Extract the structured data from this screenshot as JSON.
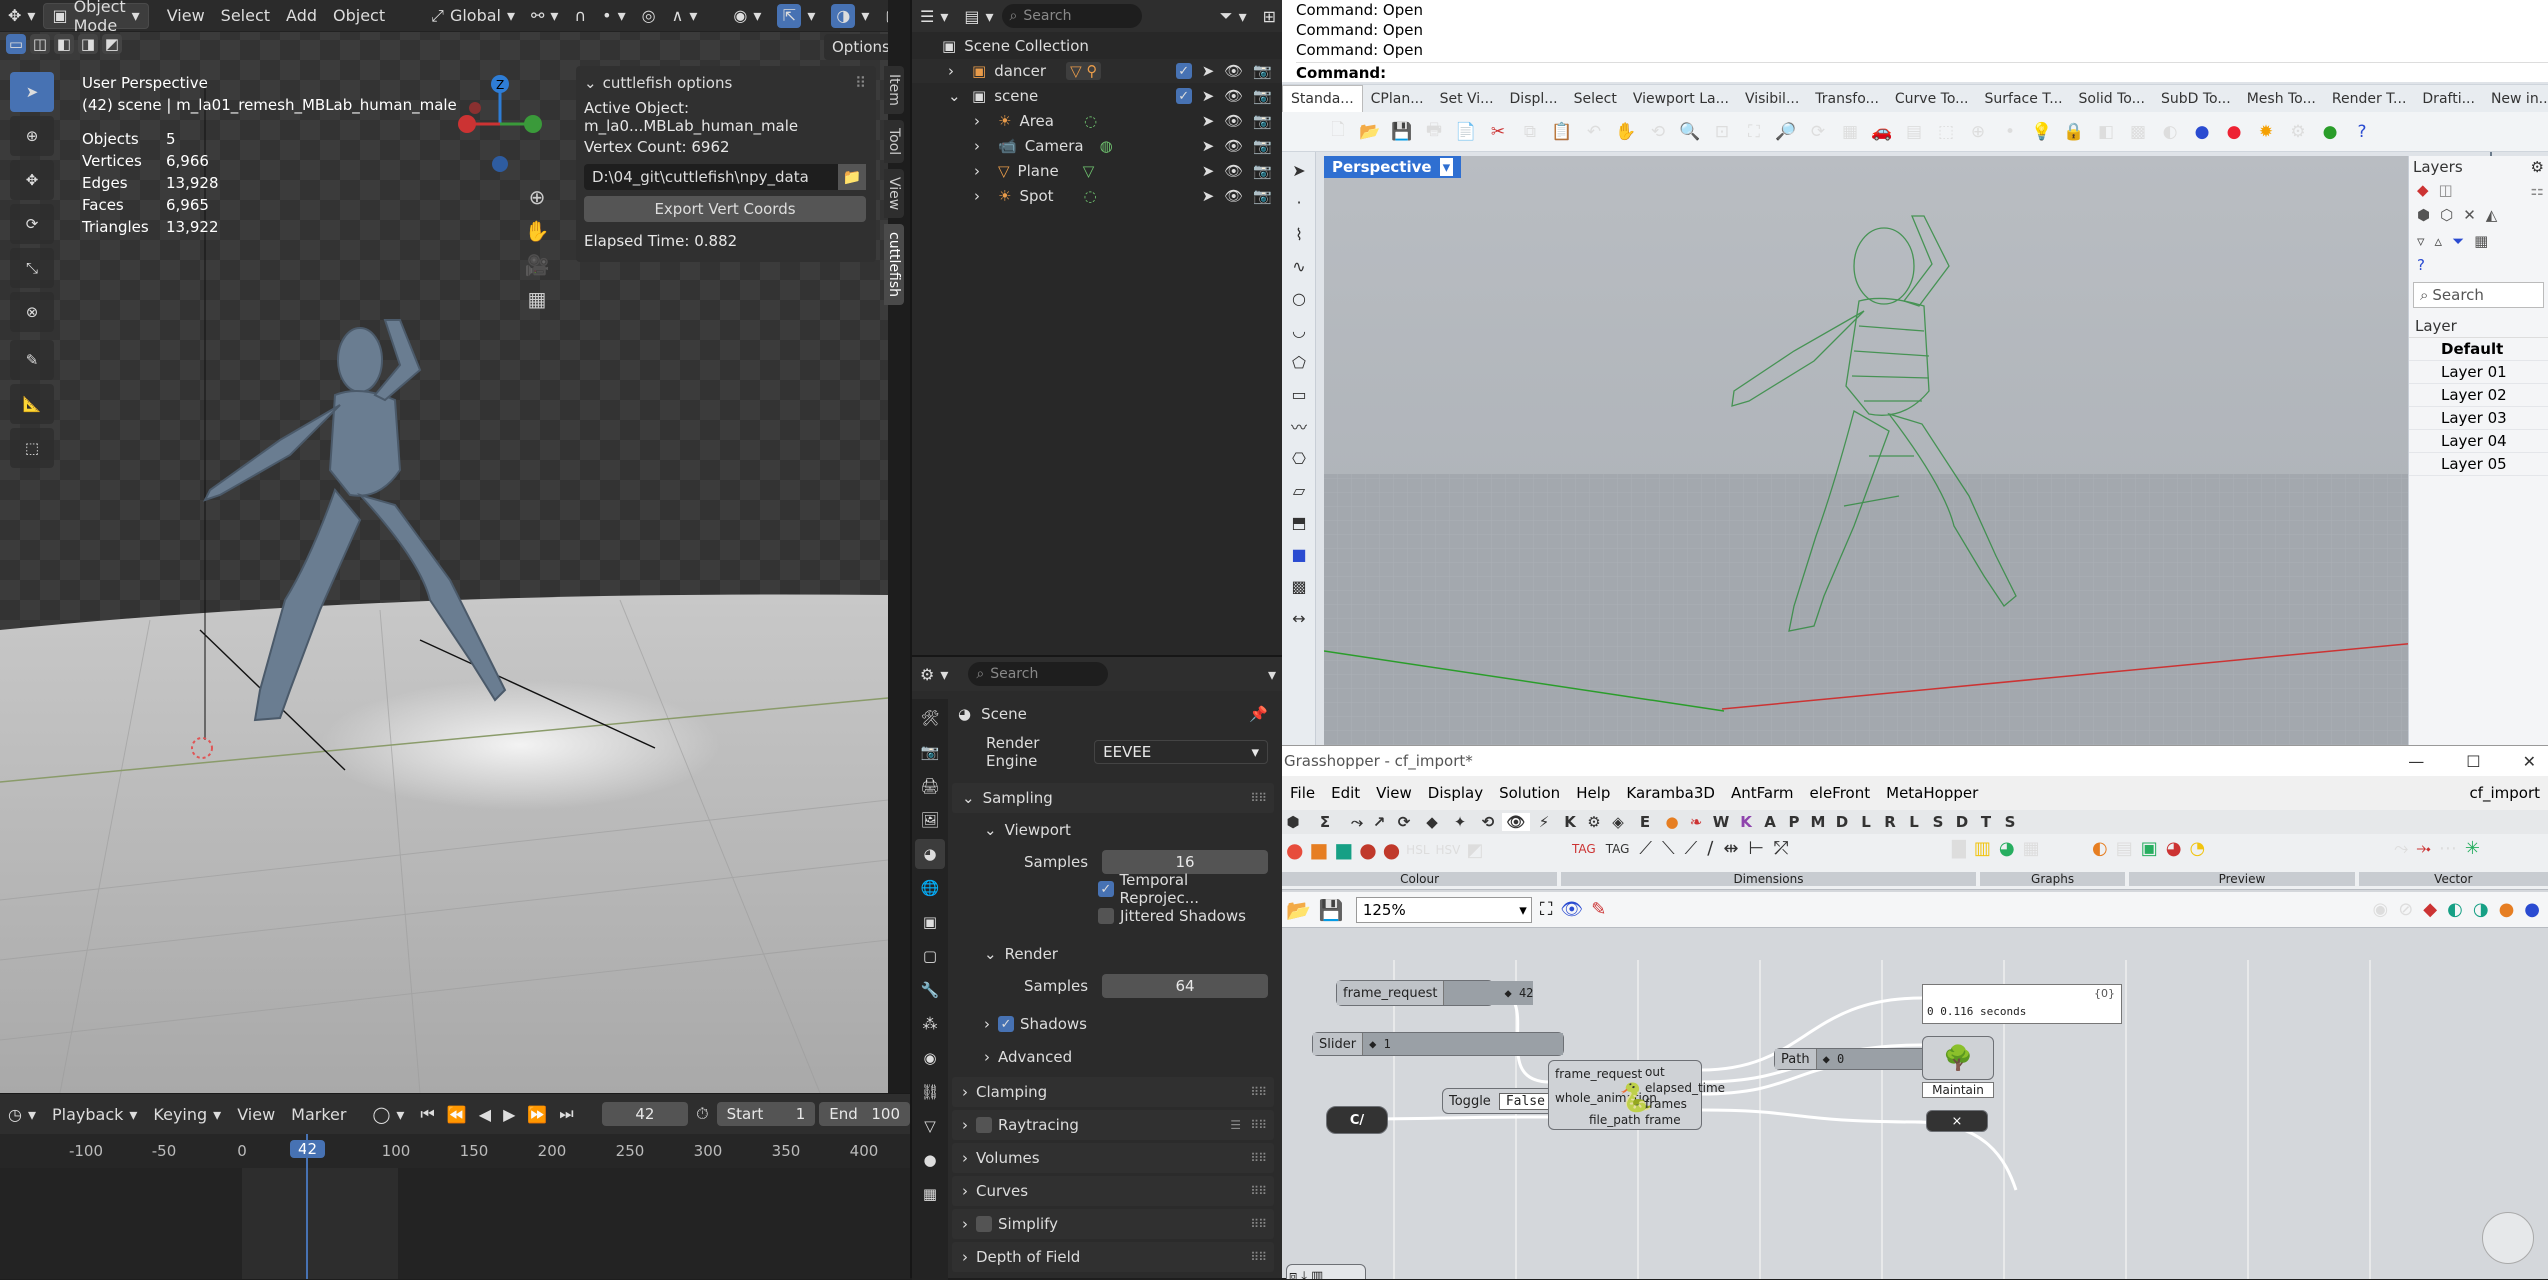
{
  "blender": {
    "header": {
      "mode": "Object Mode",
      "menus": [
        "View",
        "Select",
        "Add",
        "Object"
      ],
      "orientation": "Global",
      "options": "Options"
    },
    "viewport": {
      "perspective": "User Perspective",
      "scene_line": "(42) scene | m_la01_remesh_MBLab_human_male",
      "stats": [
        {
          "label": "Objects",
          "value": "5"
        },
        {
          "label": "Vertices",
          "value": "6,966"
        },
        {
          "label": "Edges",
          "value": "13,928"
        },
        {
          "label": "Faces",
          "value": "6,965"
        },
        {
          "label": "Triangles",
          "value": "13,922"
        }
      ]
    },
    "npanel": {
      "title": "cuttlefish options",
      "active_object": "Active Object: m_la0...MBLab_human_male",
      "vertex_count": "Vertex Count: 6962",
      "path": "D:\\04_git\\cuttlefish\\npy_data",
      "export_button": "Export Vert Coords",
      "elapsed": "Elapsed Time: 0.882"
    },
    "side_tabs": [
      "Item",
      "Tool",
      "View",
      "cuttlefish"
    ],
    "timeline": {
      "menus": [
        "Playback",
        "Keying",
        "View",
        "Marker"
      ],
      "current_frame": "42",
      "start_label": "Start",
      "start": "1",
      "end_label": "End",
      "end": "100",
      "ticks": [
        "-100",
        "-50",
        "0",
        "42",
        "100",
        "150",
        "200",
        "250",
        "300",
        "350",
        "400"
      ]
    },
    "outliner": {
      "search_placeholder": "Search",
      "root": "Scene Collection",
      "items": [
        {
          "name": "dancer",
          "level": 1
        },
        {
          "name": "scene",
          "level": 1
        },
        {
          "name": "Area",
          "level": 2
        },
        {
          "name": "Camera",
          "level": 2
        },
        {
          "name": "Plane",
          "level": 2
        },
        {
          "name": "Spot",
          "level": 2
        }
      ]
    },
    "properties": {
      "search_placeholder": "Search",
      "scene_label": "Scene",
      "render_engine_label": "Render Engine",
      "render_engine": "EEVEE",
      "sampling": "Sampling",
      "viewport": "Viewport",
      "samples_label": "Samples",
      "viewport_samples": "16",
      "temporal": "Temporal Reprojec...",
      "jittered": "Jittered Shadows",
      "render": "Render",
      "render_samples": "64",
      "shadows": "Shadows",
      "advanced": "Advanced",
      "sections": [
        "Clamping",
        "Raytracing",
        "Volumes",
        "Curves",
        "Simplify",
        "Depth of Field"
      ]
    }
  },
  "rhino": {
    "command_history": [
      "Command: Open",
      "Command: Open",
      "Command: Open"
    ],
    "command_prompt": "Command:",
    "tabs": [
      "Standa...",
      "CPlan...",
      "Set Vi...",
      "Displ...",
      "Select",
      "Viewport La...",
      "Visibil...",
      "Transfo...",
      "Curve To...",
      "Surface T...",
      "Solid To...",
      "SubD To...",
      "Mesh To...",
      "Render T...",
      "Drafti...",
      "New in..."
    ],
    "viewport_label": "Perspective",
    "layers_title": "Layers",
    "layers_search": "Search",
    "layer_header": "Layer",
    "layers": [
      "Default",
      "Layer 01",
      "Layer 02",
      "Layer 03",
      "Layer 04",
      "Layer 05"
    ]
  },
  "grasshopper": {
    "title": "Grasshopper - cf_import*",
    "doc_name": "cf_import",
    "menus": [
      "File",
      "Edit",
      "View",
      "Display",
      "Solution",
      "Help",
      "Karamba3D",
      "AntFarm",
      "eleFront",
      "MetaHopper"
    ],
    "tabs": [
      "Σ",
      "K",
      "E",
      "W",
      "P",
      "M",
      "K",
      "A",
      "D",
      "L",
      "R",
      "L",
      "S",
      "D",
      "T",
      "S"
    ],
    "ribbon_groups": [
      "Colour",
      "Dimensions",
      "Graphs",
      "Preview",
      "Vector"
    ],
    "zoom": "125%",
    "components": {
      "frame_request_label": "frame_request",
      "frame_request_value": "42",
      "slider_label": "Slider",
      "slider_value": "1",
      "toggle_label": "Toggle",
      "toggle_value": "False",
      "path_icon": "C/",
      "py_inputs": [
        "frame_request",
        "whole_animation",
        "file_path"
      ],
      "py_outputs": [
        "out",
        "elapsed_time",
        "frames",
        "frame"
      ],
      "panel_value": "0 0.116 seconds",
      "panel_index": "{0}",
      "path_label": "Path",
      "path_value": "0",
      "maintain_label": "Maintain"
    }
  }
}
